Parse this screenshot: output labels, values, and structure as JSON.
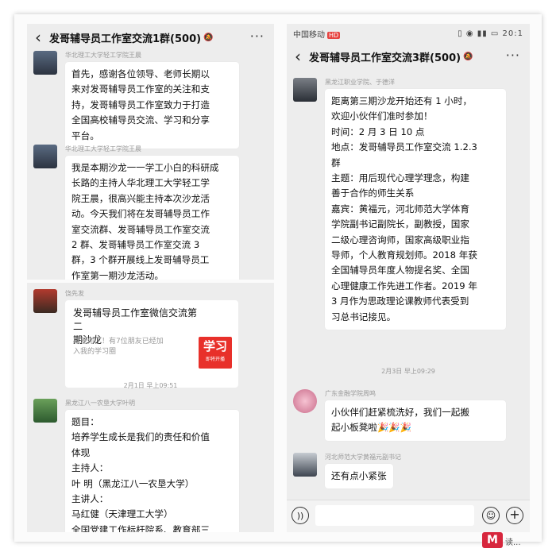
{
  "panel_a": {
    "header": {
      "back": "‹",
      "title": "发哥辅导员工作室交流1群(500)",
      "more": "···"
    },
    "messages": [
      {
        "sender": "华北理工大学轻工学院王晨",
        "lines": [
          "首先，感谢各位领导、老师长期以",
          "来对发哥辅导员工作室的关注和支",
          "持，发哥辅导员工作室致力于打造",
          "全国高校辅导员交流、学习和分享",
          "平台。"
        ]
      },
      {
        "sender": "华北理工大学轻工学院王晨",
        "lines": [
          "我是本期沙龙一一学工小白的科研成",
          "长路的主持人华北理工大学轻工学",
          "院王晨，很高兴能主持本次沙龙活",
          "动。今天我们将在发哥辅导员工作",
          "室交流群、发哥辅导员工作室交流",
          "2 群、发哥辅导员工作室交流 3",
          "群，3 个群开展线上发哥辅导员工",
          "作室第一期沙龙活动。"
        ]
      }
    ]
  },
  "panel_b": {
    "card_message": {
      "sender": "饶先发",
      "title_lines": [
        "发哥辅导员工作室微信交流第二",
        "期沙龙"
      ],
      "desc_lines": [
        "就差你了！有7位朋友已经加",
        "入我的学习圈"
      ],
      "thumb_main": "学习",
      "thumb_sub": "即将开播"
    },
    "timestamp": "2月1日 早上09:51",
    "text_message": {
      "sender": "黑龙江八一农垦大学叶明",
      "lines": [
        "题目：",
        "培养学生成长是我们的责任和价值",
        "体现",
        "主持人：",
        "叶 明（黑龙江八一农垦大学）",
        "主讲人：",
        "马红健（天津理工大学）",
        "全国党建工作标杆院系、教育部三"
      ]
    }
  },
  "panel_c": {
    "status": {
      "carrier": "中国移动",
      "carrier_badge": "HD",
      "icons": "▯ ◉ ▮▮ ▭ 20:1"
    },
    "header": {
      "back": "‹",
      "title": "发哥辅导员工作室交流3群(500)",
      "more": "···"
    },
    "messages": [
      {
        "sender": "黑龙江职业学院、于德洋",
        "lines": [
          "距离第三期沙龙开始还有 1 小时，",
          "欢迎小伙伴们准时参加！",
          "时间：2 月 3 日 10 点",
          "地点：发哥辅导员工作室交流 1.2.3",
          "群",
          "主题：用后现代心理学理念，构建",
          "善于合作的师生关系",
          "嘉宾：黄福元，河北师范大学体育",
          "学院副书记副院长，副教授，国家",
          "二级心理咨询师，国家高级职业指",
          "导师，个人教育规划师。2018 年获",
          "全国辅导员年度人物提名奖、全国",
          "心理健康工作先进工作者。2019 年",
          "3 月作为思政理论课教师代表受到",
          "习总书记接见。"
        ]
      },
      {
        "sender": "广东金融学院周鸣",
        "lines": [
          "小伙伴们赶紧梳洗好，我们一起搬",
          "起小板凳啦🎉🎉🎉"
        ]
      },
      {
        "sender": "河北师范大学黄福元副书记",
        "lines": [
          "还有点小紧张"
        ]
      }
    ],
    "timestamp": "2月3日 早上09:29"
  },
  "watermark": {
    "logo": "M",
    "text": "读..."
  }
}
